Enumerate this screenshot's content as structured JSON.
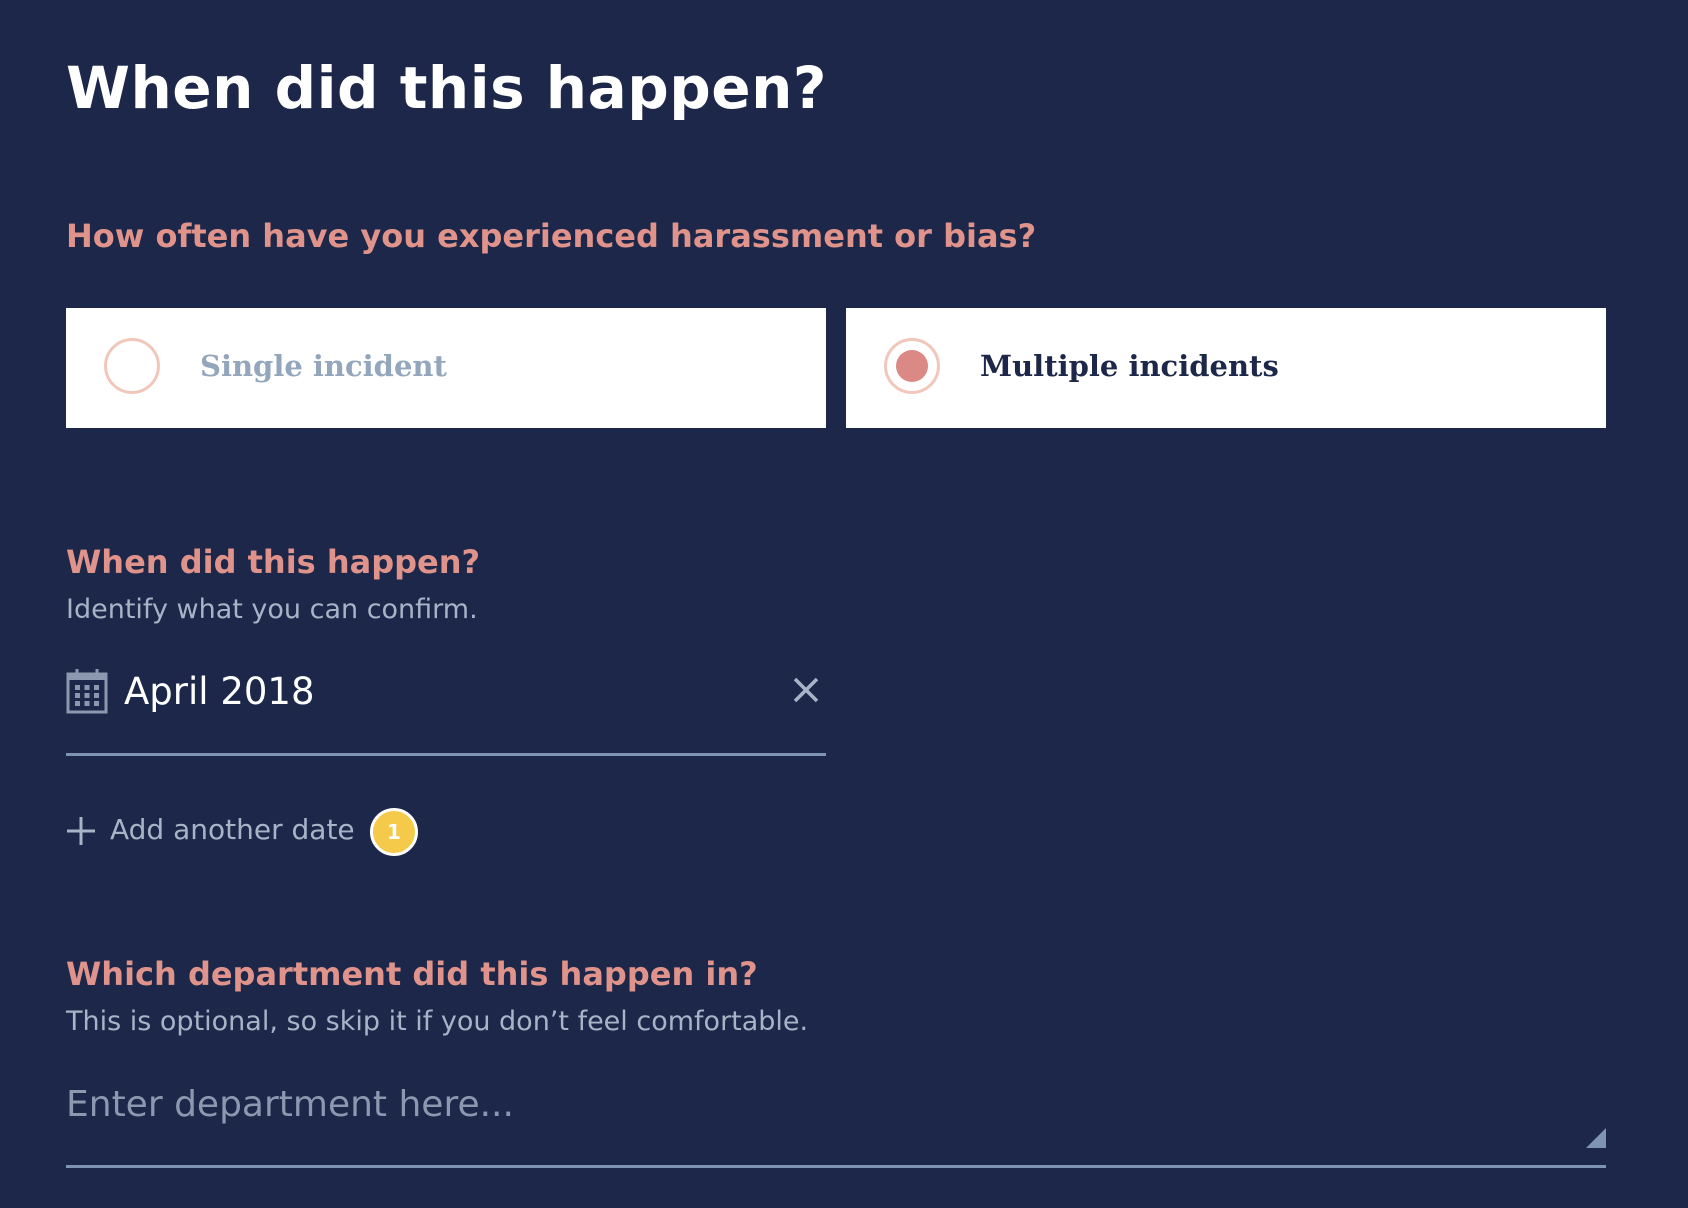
{
  "page": {
    "title": "When did this happen?"
  },
  "frequency": {
    "question": "How often have you experienced harassment or bias?",
    "options": [
      {
        "label": "Single incident",
        "selected": false
      },
      {
        "label": "Multiple incidents",
        "selected": true
      }
    ]
  },
  "dates": {
    "question": "When did this happen?",
    "hint": "Identify what you can confirm.",
    "entries": [
      {
        "value": "April 2018",
        "icon": "calendar-icon"
      }
    ],
    "add_label": "Add another date",
    "badge_count": "1"
  },
  "department": {
    "question": "Which department did this happen in?",
    "hint": "This is optional, so skip it if you don’t feel comfortable.",
    "value": "",
    "placeholder": "Enter department here..."
  },
  "colors": {
    "background": "#1c2749",
    "accent": "#e0938a",
    "radio_selected": "#da8985",
    "badge": "#f5c94a"
  }
}
